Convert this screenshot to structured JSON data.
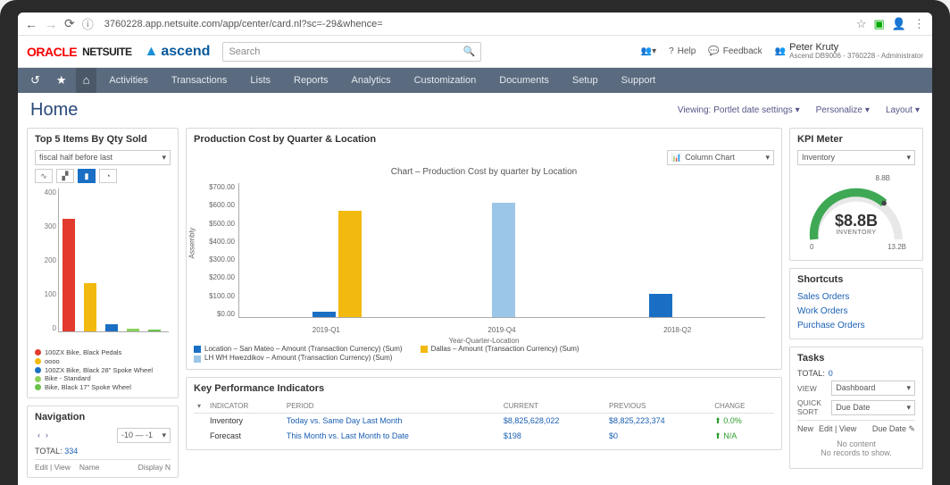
{
  "browser": {
    "url": "3760228.app.netsuite.com/app/center/card.nl?sc=-29&whence="
  },
  "header": {
    "brand1": "ORACLE",
    "brand2": "NETSUITE",
    "brand3": "ascend",
    "search_placeholder": "Search",
    "help": "Help",
    "feedback": "Feedback",
    "user_name": "Peter Kruty",
    "user_role": "Ascend DB9006 - 3760228 - Administrator"
  },
  "nav": {
    "tabs": [
      "Activities",
      "Transactions",
      "Lists",
      "Reports",
      "Analytics",
      "Customization",
      "Documents",
      "Setup",
      "Support"
    ]
  },
  "subheader": {
    "title": "Home",
    "viewing": "Viewing: Portlet date settings",
    "personalize": "Personalize",
    "layout": "Layout"
  },
  "top5": {
    "title": "Top 5 Items By Qty Sold",
    "period": "fiscal half before last",
    "legend": [
      {
        "label": "100ZX Bike, Black Pedals",
        "color": "#e23b2e"
      },
      {
        "label": "oooo",
        "color": "#f2b90f"
      },
      {
        "label": "100ZX Bike, Black 28\" Spoke Wheel",
        "color": "#1a6fc4"
      },
      {
        "label": "Bike - Standard",
        "color": "#8bd15a"
      },
      {
        "label": "Bike, Black 17\" Spoke Wheel",
        "color": "#6cc24a"
      }
    ]
  },
  "navportlet": {
    "title": "Navigation",
    "pager": "-10 — -1",
    "total_label": "TOTAL:",
    "total": "334",
    "actions": "Edit | View",
    "col_name": "Name",
    "col_display": "Display N"
  },
  "center": {
    "title": "Production Cost by Quarter & Location",
    "chart_select": "Column Chart",
    "chart_title": "Chart – Production Cost by quarter by Location",
    "ylabel": "Assembly",
    "xlabel": "Year-Quarter-Location",
    "legend": [
      {
        "label": "Location – San Mateo – Amount (Transaction Currency) (Sum)",
        "color": "#1a6fc4"
      },
      {
        "label": "Dallas – Amount (Transaction Currency) (Sum)",
        "color": "#f2b90f"
      },
      {
        "label": "LH WH Hwezdikov – Amount (Transaction Currency) (Sum)",
        "color": "#9cc6e8"
      }
    ]
  },
  "kpimeter": {
    "title": "KPI Meter",
    "select": "Inventory",
    "value": "$8.8B",
    "label": "INVENTORY",
    "min": "0",
    "max": "13.2B",
    "target": "8.8B"
  },
  "shortcuts": {
    "title": "Shortcuts",
    "links": [
      "Sales Orders",
      "Work Orders",
      "Purchase Orders"
    ]
  },
  "tasks": {
    "title": "Tasks",
    "total_label": "TOTAL:",
    "total": "0",
    "view_label": "VIEW",
    "view_value": "Dashboard",
    "sort_label": "QUICK SORT",
    "sort_value": "Due Date",
    "btn_new": "New",
    "btn_edit": "Edit | View",
    "btn_due": "Due Date",
    "empty1": "No content",
    "empty2": "No records to show."
  },
  "kpi": {
    "title": "Key Performance Indicators",
    "headers": [
      "INDICATOR",
      "PERIOD",
      "CURRENT",
      "PREVIOUS",
      "CHANGE"
    ],
    "rows": [
      {
        "indicator": "Inventory",
        "period": "Today vs. Same Day Last Month",
        "current": "$8,825,628,022",
        "previous": "$8,825,223,374",
        "change": "0.0%",
        "dir": "up"
      },
      {
        "indicator": "Forecast",
        "period": "This Month vs. Last Month to Date",
        "current": "$198",
        "previous": "$0",
        "change": "N/A",
        "dir": "up"
      }
    ]
  },
  "chart_data": [
    {
      "type": "bar",
      "title": "Top 5 Items By Qty Sold",
      "categories": [
        "100ZX Bike, Black Pedals",
        "oooo",
        "100ZX Bike, Black 28\" Spoke Wheel",
        "Bike - Standard",
        "Bike, Black 17\" Spoke Wheel"
      ],
      "values": [
        315,
        135,
        20,
        8,
        6
      ],
      "ylim": [
        0,
        400
      ],
      "ylabel": "",
      "xlabel": ""
    },
    {
      "type": "bar",
      "title": "Chart – Production Cost by quarter by Location",
      "categories": [
        "2019-Q1",
        "2019-Q4",
        "2018-Q2"
      ],
      "series": [
        {
          "name": "Location – San Mateo – Amount (Transaction Currency) (Sum)",
          "values": [
            30,
            0,
            120
          ]
        },
        {
          "name": "Dallas – Amount (Transaction Currency) (Sum)",
          "values": [
            555,
            0,
            0
          ]
        },
        {
          "name": "LH WH Hwezdikov – Amount (Transaction Currency) (Sum)",
          "values": [
            0,
            595,
            0
          ]
        }
      ],
      "ylim": [
        0,
        700
      ],
      "ylabel": "Assembly",
      "xlabel": "Year-Quarter-Location"
    }
  ]
}
